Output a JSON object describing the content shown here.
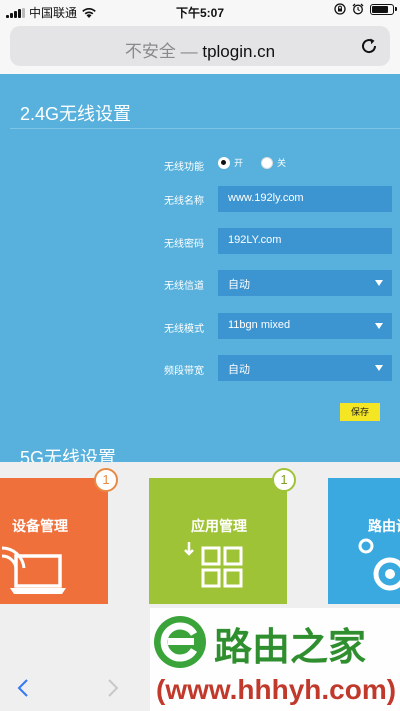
{
  "status_bar": {
    "carrier": "中国联通",
    "time": "下午5:07",
    "battery_level": 0.85
  },
  "browser": {
    "security_label": "不安全",
    "separator": "—",
    "domain": "tplogin.cn"
  },
  "wireless_24g": {
    "title": "2.4G无线设置",
    "function_label": "无线功能",
    "radio_on_label": "开",
    "radio_off_label": "关",
    "radio_selected": "开",
    "ssid_label": "无线名称",
    "ssid_value": "www.192ly.com",
    "password_label": "无线密码",
    "password_value": "192LY.com",
    "channel_label": "无线信道",
    "channel_value": "自动",
    "mode_label": "无线模式",
    "mode_value": "11bgn mixed",
    "bandwidth_label": "频段带宽",
    "bandwidth_value": "自动",
    "save_label": "保存"
  },
  "wireless_5g": {
    "title": "5G无线设置"
  },
  "app_tiles": [
    {
      "label": "设备管理",
      "badge": "1",
      "color": "#f0703c"
    },
    {
      "label": "应用管理",
      "badge": "1",
      "color": "#9fc336"
    },
    {
      "label": "路由设置",
      "color": "#39a9e0"
    }
  ],
  "watermark": {
    "title": "路由之家",
    "url": "(www.hhhyh.com)"
  },
  "colors": {
    "page_bg": "#58b1dc",
    "field_bg": "#3c94d0",
    "save_bg": "#f4e623"
  }
}
